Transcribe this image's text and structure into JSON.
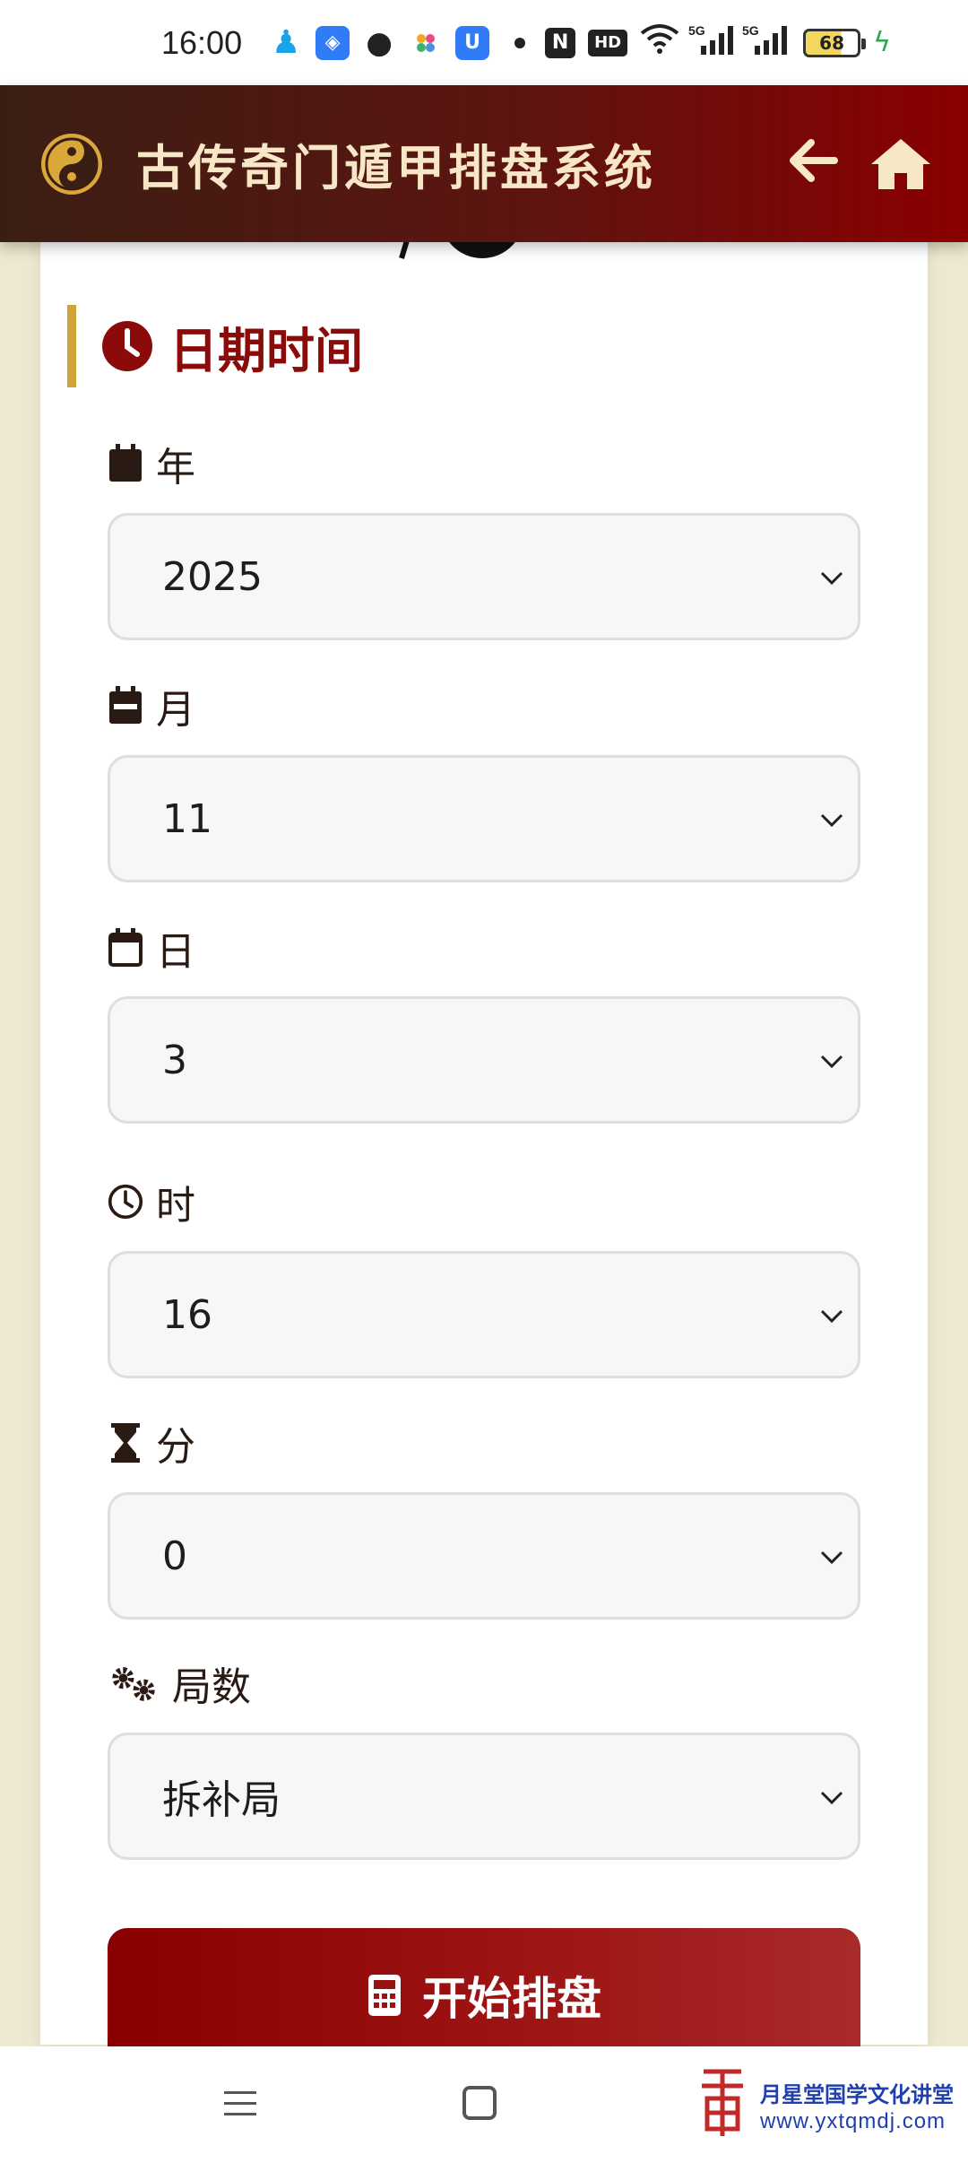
{
  "status_bar": {
    "time": "16:00",
    "battery": "68"
  },
  "header": {
    "title": "古传奇门遁甲排盘系统"
  },
  "section": {
    "title": "日期时间"
  },
  "fields": {
    "year": {
      "label": "年",
      "value": "2025"
    },
    "month": {
      "label": "月",
      "value": "11"
    },
    "day": {
      "label": "日",
      "value": "3"
    },
    "hour": {
      "label": "时",
      "value": "16"
    },
    "minute": {
      "label": "分",
      "value": "0"
    },
    "ju": {
      "label": "局数",
      "value": "拆补局"
    }
  },
  "start_button": {
    "label": "开始排盘"
  },
  "watermark": {
    "name": "月星堂国学文化讲堂",
    "url": "www.yxtqmdj.com"
  },
  "colors": {
    "header_start": "#3a1e14",
    "header_end": "#8a0000",
    "accent_red": "#8b0a0a",
    "accent_gold": "#cfa53a",
    "page_bg": "#ede8cf"
  }
}
